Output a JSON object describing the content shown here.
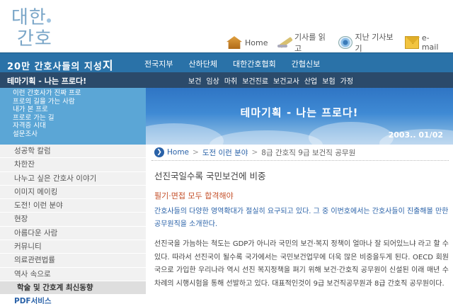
{
  "logo": {
    "line1": "대한",
    "line2": "간호"
  },
  "topnav": [
    {
      "label": "Home",
      "icon": "home-icon"
    },
    {
      "label": "기사를 읽고",
      "icon": "pencil-icon"
    },
    {
      "label": "지난 기사보기",
      "icon": "eye-icon"
    },
    {
      "label": "e-mail",
      "icon": "mail-icon"
    }
  ],
  "menubar": {
    "slogan_prefix": "20만 간호사들의 지성",
    "slogan_emph": "지",
    "items": [
      "전국지부",
      "산하단체",
      "대한간호협회",
      "간협신보"
    ]
  },
  "subbar": {
    "section_title": "테마기획 - 나는 프로다!",
    "items": [
      "보건",
      "임상",
      "마취",
      "보건진료",
      "보건교사",
      "산업",
      "보험",
      "가정"
    ]
  },
  "subnav": [
    "이런 간호사가 진짜 프로",
    "프로의 길을 가는 사람",
    "내가 본 프로",
    "프로로 가는 길",
    "자격증 시대",
    "설문조사"
  ],
  "banner": {
    "title": "테마기획 - 나는 프로다!",
    "date": "2003.. 01/02"
  },
  "sidebar": [
    "성공학 칼럼",
    "차한잔",
    "나누고 싶은 간호사 이야기",
    "이미지 메이킹",
    "도전! 이런 분야",
    "현장",
    "아름다운 사람",
    "커뮤니티",
    "의료관련법률",
    "역사 속으로",
    "학술 및 간호계 최신동향",
    "PDF서비스"
  ],
  "breadcrumb": {
    "home": "Home",
    "level1": "도전 이런 분야",
    "level2": "8급 간호직 9급 보건직 공무원"
  },
  "article": {
    "title": "선진국일수록 국민보건에 비중",
    "subtitle": "필기·면접 모두 합격해야",
    "intro": "간호사들의 다양한 영역확대가 절실히 요구되고 있다. 그 중 이번호에서는 간호사들이 진출해볼 만한 공무원직을 소개한다.",
    "body": "선진국을 가늠하는 척도는 GDP가 아니라 국민의 보건·복지 정책이 얼마나 잘 되어있느냐 라고 할 수 있다. 따라서 선진국이 될수록 국가에서는 국민보건업무에 더욱 많은 비중을두게 된다. OECD 회원국으로 가입한 우리나라 역시 선진 복지정책을 펴기 위해 보건·간호직 공무원이 신설된 이래 매년 수 차례의 시행시험을 통해 선발하고 있다. 대표적인것이 9급 보건직공무원과 8급 간호직 공무원이다."
  }
}
